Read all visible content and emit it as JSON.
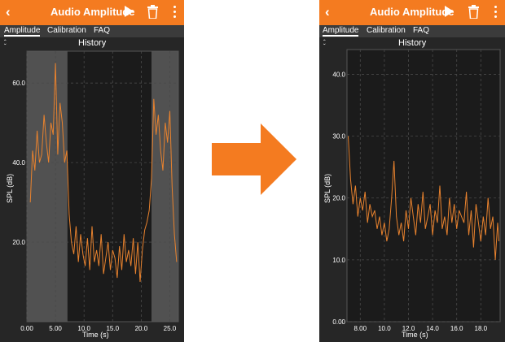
{
  "app": {
    "title": "Audio Amplitude",
    "back_icon": "back-chevron-icon",
    "play_icon": "play-icon",
    "trash_icon": "trash-icon",
    "menu_icon": "overflow-menu-icon"
  },
  "tabs": [
    {
      "label": "Amplitude",
      "active": true
    },
    {
      "label": "Calibration",
      "active": false
    },
    {
      "label": "FAQ",
      "active": false
    }
  ],
  "colors": {
    "accent": "#f47b20",
    "background": "#262626",
    "trace": "#e8822e",
    "selection": "#5a5a5a"
  },
  "collapse_icon": "collapse-chevrons-icon",
  "transition_arrow_icon": "right-arrow-icon",
  "chart_data": [
    {
      "type": "line",
      "title": "History",
      "xlabel": "Time (s)",
      "ylabel": "SPL (dB)",
      "xlim": [
        0,
        26.5
      ],
      "ylim": [
        0,
        68
      ],
      "x_ticks": [
        "0.00",
        "5.00",
        "10.0",
        "15.0",
        "20.0",
        "25.0"
      ],
      "x_tick_values": [
        0,
        5,
        10,
        15,
        20,
        25
      ],
      "y_ticks": [
        "20.0",
        "40.0",
        "60.0"
      ],
      "y_tick_values": [
        20,
        40,
        60
      ],
      "grid": true,
      "highlighted_ranges": [
        [
          0,
          7.1
        ],
        [
          21.8,
          26.5
        ]
      ],
      "series": [
        {
          "x": [
            0.6,
            1.0,
            1.4,
            1.8,
            2.2,
            2.6,
            3.0,
            3.4,
            3.8,
            4.2,
            4.6,
            5.0,
            5.4,
            5.8,
            6.2,
            6.6,
            7.0,
            7.4,
            7.8,
            8.2,
            8.6,
            9.0,
            9.4,
            9.8,
            10.2,
            10.6,
            11.0,
            11.4,
            11.8,
            12.2,
            12.6,
            13.0,
            13.4,
            13.8,
            14.2,
            14.6,
            15.0,
            15.4,
            15.8,
            16.2,
            16.6,
            17.0,
            17.4,
            17.8,
            18.2,
            18.6,
            19.0,
            19.4,
            19.8,
            20.2,
            20.6,
            21.0,
            21.4,
            21.8,
            22.2,
            22.6,
            23.0,
            23.4,
            23.8,
            24.2,
            24.6,
            25.0,
            25.4,
            25.8,
            26.2
          ],
          "y": [
            30,
            43,
            38,
            48,
            40,
            42,
            52,
            45,
            40,
            50,
            47,
            65,
            42,
            55,
            50,
            40,
            43,
            27,
            20,
            17,
            24,
            15,
            22,
            17,
            14,
            21,
            13,
            24,
            15,
            18,
            14,
            22,
            12,
            16,
            20,
            13,
            18,
            16,
            11,
            19,
            13,
            22,
            15,
            18,
            14,
            21,
            12,
            20,
            10,
            18,
            23,
            25,
            28,
            36,
            56,
            47,
            52,
            43,
            38,
            50,
            45,
            53,
            34,
            22,
            15
          ]
        }
      ]
    },
    {
      "type": "line",
      "title": "History",
      "xlabel": "Time (s)",
      "ylabel": "SPL (dB)",
      "xlim": [
        6.9,
        19.6
      ],
      "ylim": [
        0,
        44
      ],
      "x_ticks": [
        "8.00",
        "10.0",
        "12.0",
        "14.0",
        "16.0",
        "18.0"
      ],
      "x_tick_values": [
        8,
        10,
        12,
        14,
        16,
        18
      ],
      "y_ticks": [
        "0.00",
        "10.0",
        "20.0",
        "30.0",
        "40.0"
      ],
      "y_tick_values": [
        0,
        10,
        20,
        30,
        40
      ],
      "grid": true,
      "series": [
        {
          "x": [
            7.0,
            7.2,
            7.4,
            7.6,
            7.8,
            8.0,
            8.2,
            8.4,
            8.6,
            8.8,
            9.0,
            9.2,
            9.4,
            9.6,
            9.8,
            10.0,
            10.2,
            10.4,
            10.6,
            10.8,
            11.0,
            11.2,
            11.4,
            11.6,
            11.8,
            12.0,
            12.2,
            12.4,
            12.6,
            12.8,
            13.0,
            13.2,
            13.4,
            13.6,
            13.8,
            14.0,
            14.2,
            14.4,
            14.6,
            14.8,
            15.0,
            15.2,
            15.4,
            15.6,
            15.8,
            16.0,
            16.2,
            16.4,
            16.6,
            16.8,
            17.0,
            17.2,
            17.4,
            17.6,
            17.8,
            18.0,
            18.2,
            18.4,
            18.6,
            18.8,
            19.0,
            19.2,
            19.4,
            19.5
          ],
          "y": [
            30,
            23,
            19,
            22,
            17,
            20,
            18,
            21,
            16,
            19,
            17,
            18,
            15,
            17,
            14,
            16,
            13,
            15,
            20,
            26,
            17,
            14,
            16,
            13,
            18,
            15,
            20,
            17,
            14,
            19,
            16,
            21,
            15,
            17,
            19,
            14,
            18,
            16,
            22,
            15,
            17,
            14,
            20,
            16,
            19,
            15,
            18,
            17,
            16,
            21,
            14,
            18,
            12,
            19,
            16,
            13,
            17,
            14,
            20,
            15,
            17,
            10,
            16,
            13
          ]
        }
      ]
    }
  ]
}
